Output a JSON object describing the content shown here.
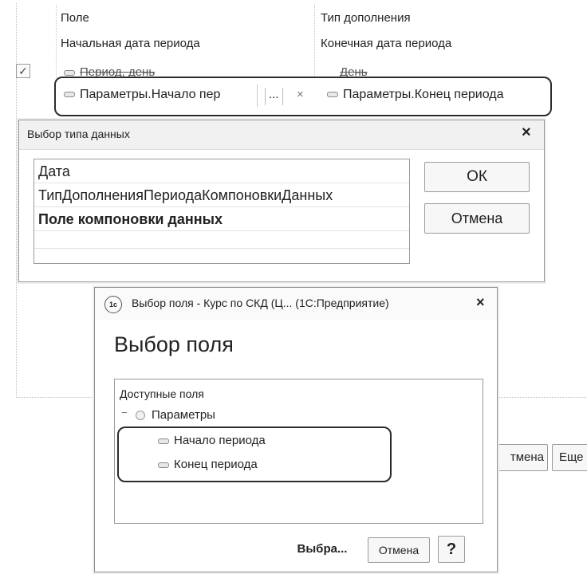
{
  "table": {
    "col1_header": "Поле",
    "col2_header": "Тип дополнения",
    "col1_subheader": "Начальная дата периода",
    "col2_subheader": "Конечная дата периода",
    "row1_col1": "Период, день",
    "row1_col2": "День",
    "row2_col1": "Параметры.Начало пер",
    "row2_col1_button": "...",
    "row2_clear": "×",
    "row2_col2": "Параметры.Конец периода",
    "checkbox_mark": "✓"
  },
  "type_dialog": {
    "title": "Выбор типа данных",
    "close": "×",
    "items": [
      {
        "label": "Дата"
      },
      {
        "label": "ТипДополненияПериодаКомпоновкиДанных"
      },
      {
        "label": "Поле компоновки данных"
      },
      {
        "label": ""
      }
    ],
    "ok_label": "ОК",
    "cancel_label": "Отмена"
  },
  "background_buttons": {
    "cancel_partial": "тмена",
    "more_partial": "Еще"
  },
  "field_dialog": {
    "logo": "1c",
    "title": "Выбор поля - Курс по СКД (Ц... (1С:Предприятие)",
    "close": "×",
    "heading": "Выбор поля",
    "tree_header": "Доступные поля",
    "group_label": "Параметры",
    "expander": "−",
    "items": [
      {
        "label": "Начало периода"
      },
      {
        "label": "Конец периода"
      }
    ],
    "select_label": "Выбра...",
    "cancel_label": "Отмена",
    "help_label": "?"
  }
}
